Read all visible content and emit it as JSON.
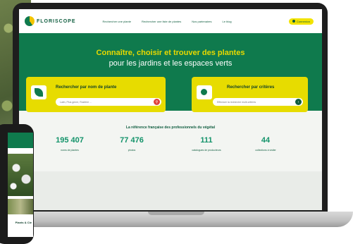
{
  "brand": {
    "name": "FLORISCOPE"
  },
  "nav": {
    "items": [
      "Rechercher une plante",
      "Rechercher une liste de plantes",
      "Nos partenaires",
      "Le blog"
    ],
    "connect_label": "Connexion"
  },
  "hero": {
    "title": "Connaître, choisir et trouver des plantes",
    "subtitle": "pour les jardins et les espaces verts"
  },
  "search_by_name": {
    "title": "Rechercher par nom de plante",
    "placeholder": "Latin, Plus genre, Rosifere ...",
    "button_icon": "search-icon"
  },
  "search_by_criteria": {
    "title": "Rechercher par critères",
    "placeholder": "Effectuer la recherche multi-critères",
    "button_icon": "arrow-right-icon"
  },
  "stats": {
    "heading": "La référence française des professionnels du végétal",
    "items": [
      {
        "value": "195 407",
        "label": "noms de plantes"
      },
      {
        "value": "77 476",
        "label": "photos"
      },
      {
        "value": "111",
        "label": "catalogues de producteurs"
      },
      {
        "value": "44",
        "label": "collections à visiter"
      }
    ]
  },
  "phone": {
    "label": "Plants & Cie"
  },
  "colors": {
    "primary_green": "#0f7a4d",
    "accent_yellow": "#e7dc00",
    "stat_green": "#13936a"
  }
}
